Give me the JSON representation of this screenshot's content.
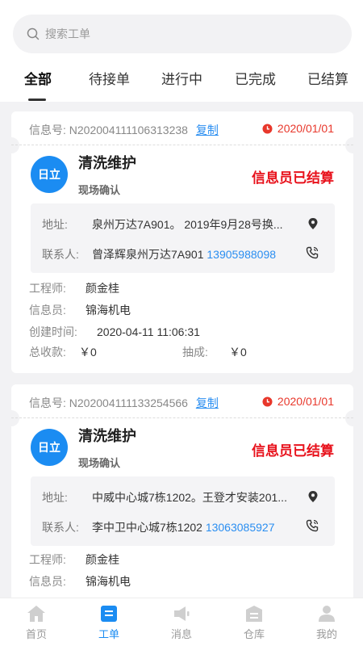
{
  "search": {
    "placeholder": "搜索工单"
  },
  "tabs": [
    "全部",
    "待接单",
    "进行中",
    "已完成",
    "已结算"
  ],
  "orders": [
    {
      "info_label": "信息号:",
      "info_no": "N202004111106313238",
      "copy": "复制",
      "date": "2020/01/01",
      "logo": "日立",
      "title": "清洗维护",
      "subtitle": "现场确认",
      "status": "信息员已结算",
      "address_label": "地址:",
      "address": "泉州万达7A901。 2019年9月28号换...",
      "contact_label": "联系人:",
      "contact": "曾泽辉泉州万达7A901",
      "phone": "13905988098",
      "engineer_label": "工程师:",
      "engineer": "颜金桂",
      "informant_label": "信息员:",
      "informant": "锦海机电",
      "created_label": "创建时间:",
      "created": "2020-04-11 11:06:31",
      "total_label": "总收款:",
      "total": "￥0",
      "commission_label": "抽成:",
      "commission": "￥0"
    },
    {
      "info_label": "信息号:",
      "info_no": "N202004111133254566",
      "copy": "复制",
      "date": "2020/01/01",
      "logo": "日立",
      "title": "清洗维护",
      "subtitle": "现场确认",
      "status": "信息员已结算",
      "address_label": "地址:",
      "address": "中威中心城7栋1202。王登才安装201...",
      "contact_label": "联系人:",
      "contact": "李中卫中心城7栋1202",
      "phone": "13063085927",
      "engineer_label": "工程师:",
      "engineer": "颜金桂",
      "informant_label": "信息员:",
      "informant": "锦海机电"
    }
  ],
  "tabbar": [
    "首页",
    "工单",
    "消息",
    "仓库",
    "我的"
  ],
  "colors": {
    "accent": "#1b8cf2",
    "status_red": "#e8121c",
    "date_red": "#e8372b",
    "link": "#2a8ef1"
  }
}
